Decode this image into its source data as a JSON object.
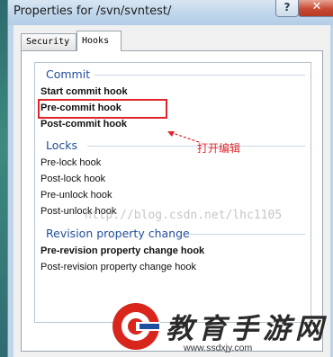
{
  "window": {
    "title": "Properties for /svn/svntest/",
    "help_label": "?",
    "close_label": "✕"
  },
  "tabs": [
    {
      "label": "Security",
      "active": false
    },
    {
      "label": "Hooks",
      "active": true
    }
  ],
  "groups": [
    {
      "title": "Commit",
      "hooks": [
        {
          "label": "Start commit hook",
          "bold": true
        },
        {
          "label": "Pre-commit hook",
          "bold": true,
          "highlighted": true
        },
        {
          "label": "Post-commit hook",
          "bold": true
        }
      ]
    },
    {
      "title": "Locks",
      "hooks": [
        {
          "label": "Pre-lock hook",
          "bold": false
        },
        {
          "label": "Post-lock hook",
          "bold": false
        },
        {
          "label": "Pre-unlock hook",
          "bold": false
        },
        {
          "label": "Post-unlock hook",
          "bold": false
        }
      ]
    },
    {
      "title": "Revision property change",
      "hooks": [
        {
          "label": "Pre-revision property change hook",
          "bold": true
        },
        {
          "label": "Post-revision property change hook",
          "bold": false
        }
      ]
    }
  ],
  "annotation": {
    "note": "打开编辑",
    "color": "#e0242a"
  },
  "watermark": {
    "text": "http://blog.csdn.net/lhc1105"
  },
  "brand": {
    "name": "教育手游网",
    "url": "www.ssdxjy.com",
    "logo_icon": "brand-logo-icon",
    "accent": "#d8261c"
  }
}
